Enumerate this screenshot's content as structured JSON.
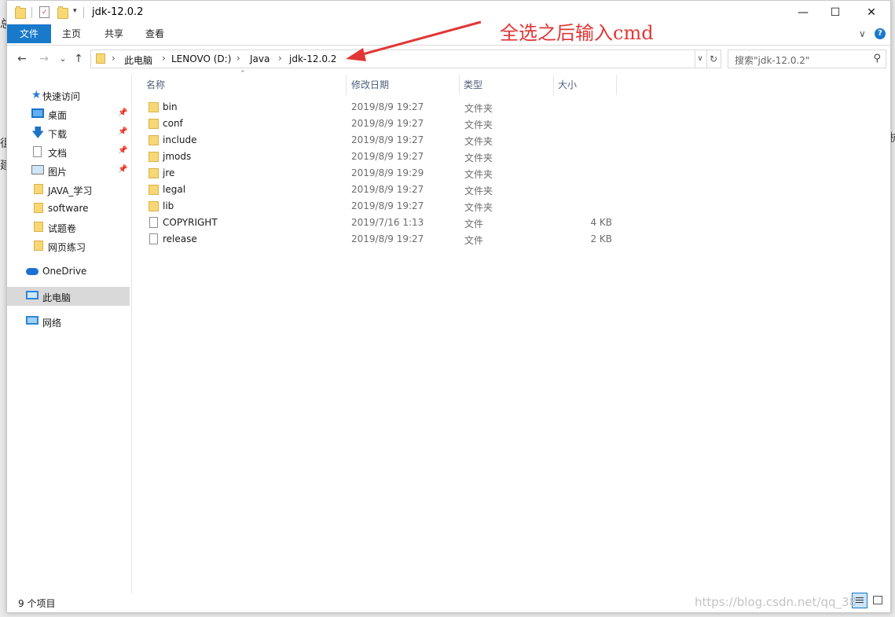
{
  "window": {
    "title": "jdk-12.0.2"
  },
  "title_controls": {
    "minimize": "—",
    "maximize": "☐",
    "close": "✕"
  },
  "ribbon": {
    "tabs": [
      {
        "label": "文件"
      },
      {
        "label": "主页"
      },
      {
        "label": "共享"
      },
      {
        "label": "查看"
      }
    ],
    "expand": "∨",
    "help": "?"
  },
  "nav": {
    "back": "←",
    "forward": "→",
    "recent": "⌄",
    "up": "↑"
  },
  "address": {
    "crumbs": [
      "此电脑",
      "LENOVO (D:)",
      "Java",
      "jdk-12.0.2"
    ],
    "dropdown": "∨",
    "refresh": "↻"
  },
  "search": {
    "placeholder": "搜索\"jdk-12.0.2\"",
    "icon": "search-icon"
  },
  "navpane": {
    "items": [
      {
        "label": "快速访问",
        "icon": "star-icon"
      },
      {
        "label": "桌面",
        "icon": "desktop-icon",
        "pinned": true
      },
      {
        "label": "下载",
        "icon": "download-icon",
        "pinned": true
      },
      {
        "label": "文档",
        "icon": "document-icon",
        "pinned": true
      },
      {
        "label": "图片",
        "icon": "pictures-icon",
        "pinned": true
      },
      {
        "label": "JAVA_学习",
        "icon": "folder-icon"
      },
      {
        "label": "software",
        "icon": "folder-icon"
      },
      {
        "label": "试题卷",
        "icon": "folder-icon"
      },
      {
        "label": "网页练习",
        "icon": "folder-icon"
      },
      {
        "label": "OneDrive",
        "icon": "cloud-icon"
      },
      {
        "label": "此电脑",
        "icon": "computer-icon",
        "selected": true
      },
      {
        "label": "网络",
        "icon": "network-icon"
      }
    ]
  },
  "columns": {
    "name": "名称",
    "date": "修改日期",
    "type": "类型",
    "size": "大小"
  },
  "files": [
    {
      "name": "bin",
      "date": "2019/8/9 19:27",
      "type": "文件夹",
      "size": "",
      "kind": "folder"
    },
    {
      "name": "conf",
      "date": "2019/8/9 19:27",
      "type": "文件夹",
      "size": "",
      "kind": "folder"
    },
    {
      "name": "include",
      "date": "2019/8/9 19:27",
      "type": "文件夹",
      "size": "",
      "kind": "folder"
    },
    {
      "name": "jmods",
      "date": "2019/8/9 19:27",
      "type": "文件夹",
      "size": "",
      "kind": "folder"
    },
    {
      "name": "jre",
      "date": "2019/8/9 19:29",
      "type": "文件夹",
      "size": "",
      "kind": "folder"
    },
    {
      "name": "legal",
      "date": "2019/8/9 19:27",
      "type": "文件夹",
      "size": "",
      "kind": "folder"
    },
    {
      "name": "lib",
      "date": "2019/8/9 19:27",
      "type": "文件夹",
      "size": "",
      "kind": "folder"
    },
    {
      "name": "COPYRIGHT",
      "date": "2019/7/16 1:13",
      "type": "文件",
      "size": "4 KB",
      "kind": "file"
    },
    {
      "name": "release",
      "date": "2019/8/9 19:27",
      "type": "文件",
      "size": "2 KB",
      "kind": "file"
    }
  ],
  "status": {
    "count": "9 个项目"
  },
  "annotation": {
    "text": "全选之后输入cmd",
    "color": "#e23636"
  },
  "watermark": "https://blog.csdn.net/qq_38",
  "colors": {
    "file_tab": "#1979ca",
    "selection": "#d9d9d9",
    "folder": "#f8d775"
  }
}
